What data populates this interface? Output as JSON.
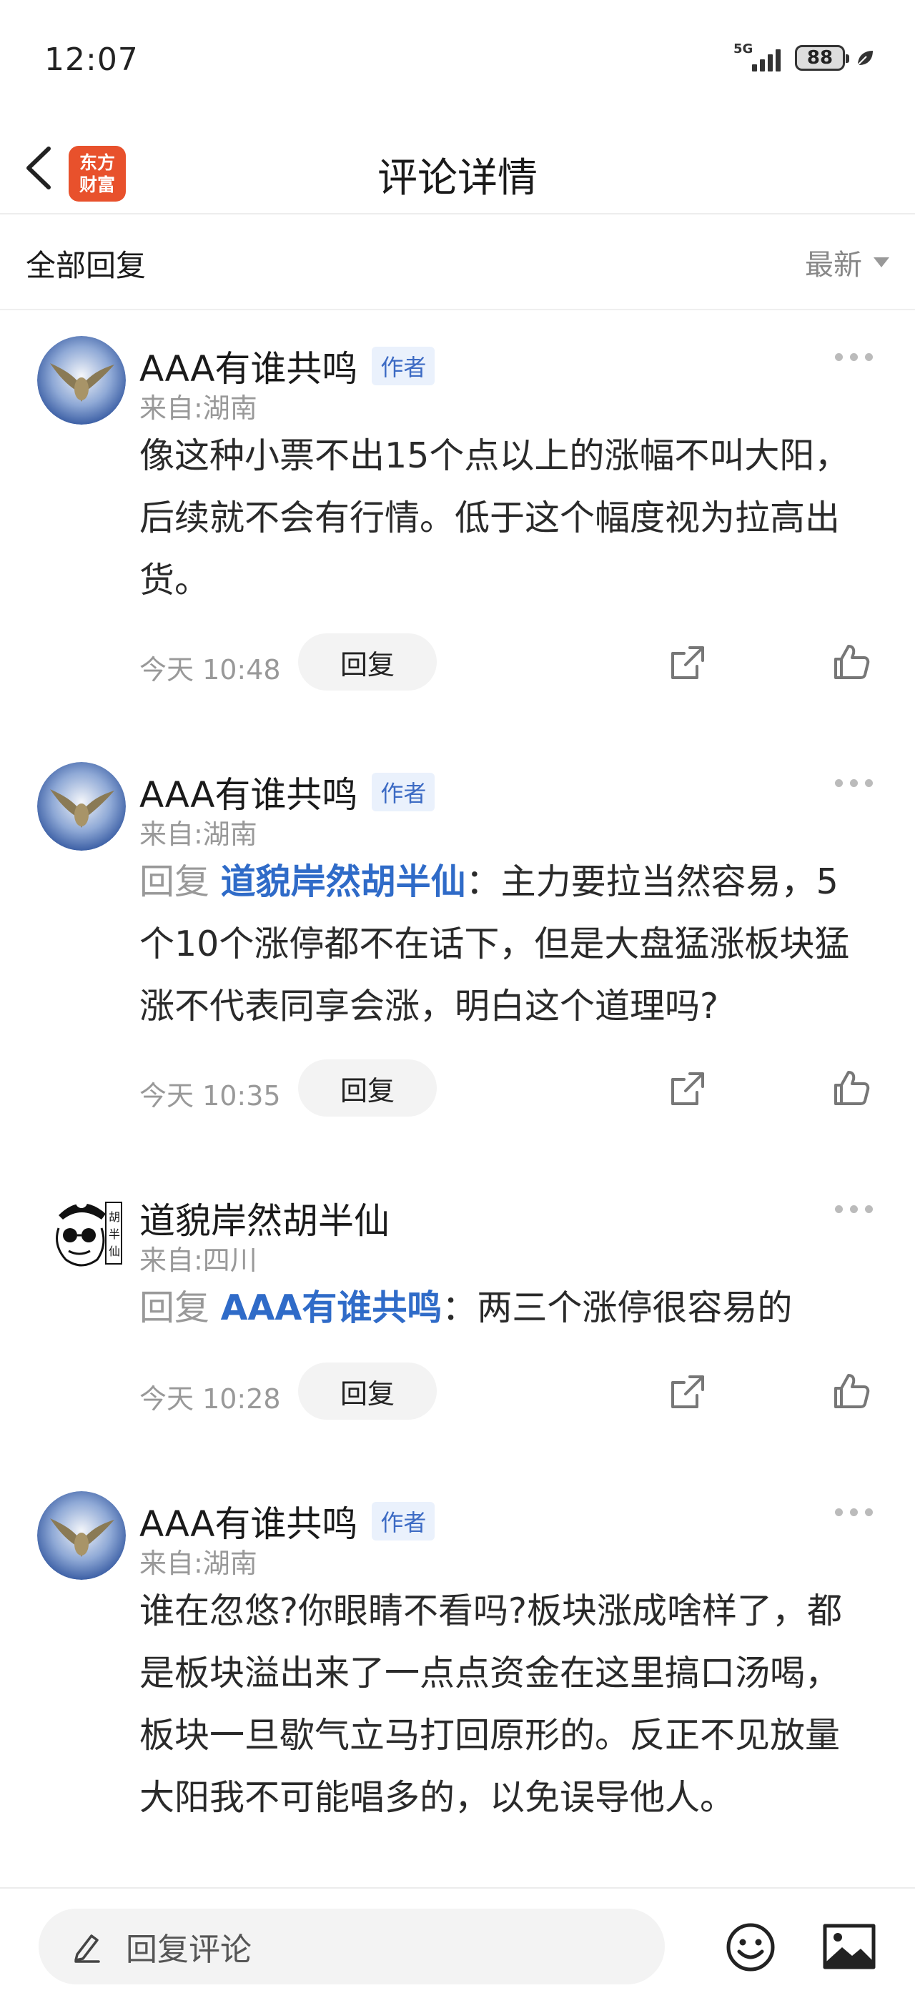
{
  "status_bar": {
    "time": "12:07",
    "network": "5G",
    "battery": "88"
  },
  "header": {
    "logo_text": "东方\n财富",
    "title": "评论详情"
  },
  "filter": {
    "title": "全部回复",
    "sort_label": "最新"
  },
  "comments": [
    {
      "username": "AAA有谁共鸣",
      "tag": "作者",
      "location": "来自:湖南",
      "reply_prefix": "",
      "mention": "",
      "separator": "",
      "text": "像这种小票不出15个点以上的涨幅不叫大阳，后续就不会有行情。低于这个幅度视为拉高出货。",
      "time": "今天 10:48",
      "reply_label": "回复"
    },
    {
      "username": "AAA有谁共鸣",
      "tag": "作者",
      "location": "来自:湖南",
      "reply_prefix": "回复 ",
      "mention": "道貌岸然胡半仙",
      "separator": "：",
      "text": "主力要拉当然容易，5个10个涨停都不在话下，但是大盘猛涨板块猛涨不代表同享会涨，明白这个道理吗?",
      "time": "今天 10:35",
      "reply_label": "回复"
    },
    {
      "username": "道貌岸然胡半仙",
      "tag": "",
      "location": "来自:四川",
      "reply_prefix": "回复 ",
      "mention": "AAA有谁共鸣",
      "separator": "：",
      "text": "两三个涨停很容易的",
      "time": "今天 10:28",
      "reply_label": "回复"
    },
    {
      "username": "AAA有谁共鸣",
      "tag": "作者",
      "location": "来自:湖南",
      "reply_prefix": "",
      "mention": "",
      "separator": "",
      "text": "谁在忽悠?你眼睛不看吗?板块涨成啥样了，都是板块溢出来了一点点资金在这里搞口汤喝，板块一旦歇气立马打回原形的。反正不见放量大阳我不可能唱多的，以免误导他人。",
      "time": "",
      "reply_label": ""
    }
  ],
  "bottom_bar": {
    "reply_placeholder": "回复评论"
  },
  "icons": {
    "back": "back-arrow-icon",
    "more": "more-dots-icon",
    "share": "share-icon",
    "like": "thumbs-up-icon",
    "pencil": "pencil-icon",
    "emoji": "emoji-icon",
    "image": "image-icon"
  },
  "colors": {
    "brand": "#e8512c",
    "link": "#2f6bc8",
    "tag_bg": "#eaf1fc",
    "tag_text": "#3d6bc4"
  }
}
